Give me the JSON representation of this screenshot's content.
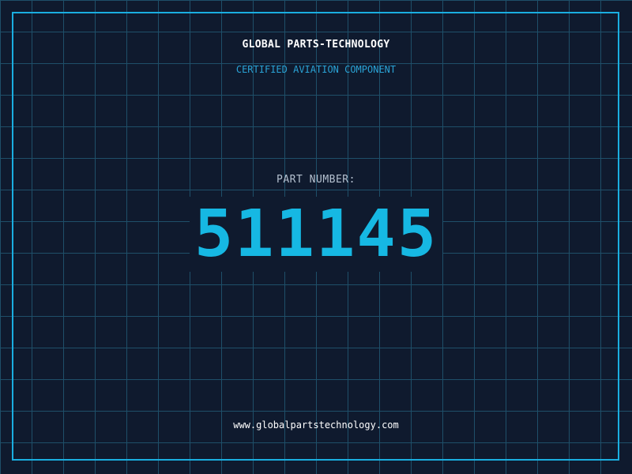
{
  "header": {
    "company": "GLOBAL PARTS-TECHNOLOGY",
    "subtitle": "CERTIFIED AVIATION COMPONENT"
  },
  "part": {
    "label": "PART NUMBER:",
    "number": "511145"
  },
  "footer": {
    "website": "www.globalpartstechnology.com"
  },
  "colors": {
    "background": "#0f1a2e",
    "grid": "#1e4f69",
    "accent": "#16b8e3",
    "frame": "#1aaee0"
  }
}
